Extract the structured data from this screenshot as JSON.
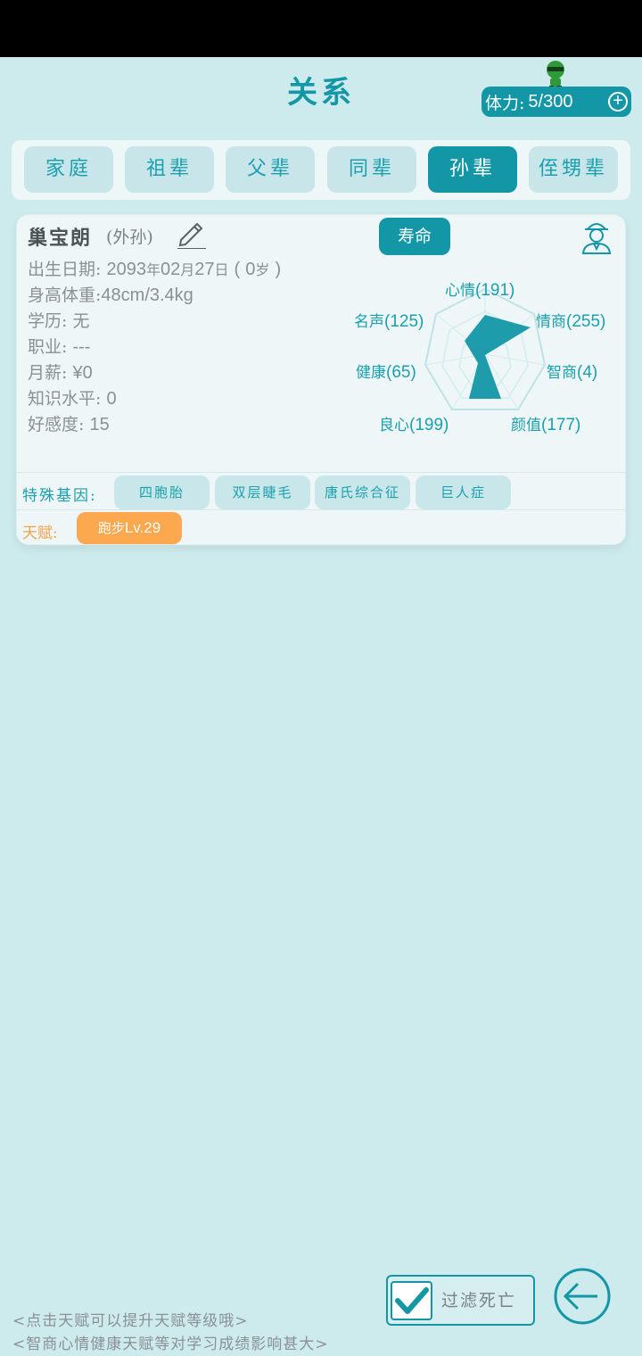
{
  "header": {
    "title": "关系",
    "stamina_label": "体力:",
    "stamina_value": "5/300"
  },
  "tabs": [
    {
      "label": "家庭",
      "active": false
    },
    {
      "label": "祖辈",
      "active": false
    },
    {
      "label": "父辈",
      "active": false
    },
    {
      "label": "同辈",
      "active": false
    },
    {
      "label": "孙辈",
      "active": true
    },
    {
      "label": "侄甥辈",
      "active": false
    }
  ],
  "card": {
    "name": "巢宝朗",
    "relation": "(外孙)",
    "lifespan_button": "寿命",
    "birth_label": "出生日期:",
    "birth_year": "2093",
    "birth_year_unit": "年",
    "birth_month": "02",
    "birth_month_unit": "月",
    "birth_day": "27",
    "birth_day_unit": "日",
    "age_open": "(",
    "age": "0",
    "age_unit": "岁",
    "age_close": ")",
    "height_weight_label": "身高体重:",
    "height_weight": "48cm/3.4kg",
    "education_label": "学历:",
    "education": "无",
    "job_label": "职业:",
    "job": "---",
    "salary_label": "月薪:",
    "salary": "¥0",
    "knowledge_label": "知识水平:",
    "knowledge": "0",
    "favor_label": "好感度:",
    "favor": "15",
    "stats": [
      {
        "name": "心情",
        "value": "(191)"
      },
      {
        "name": "情商",
        "value": "(255)"
      },
      {
        "name": "智商",
        "value": "(4)"
      },
      {
        "name": "颜值",
        "value": "(177)"
      },
      {
        "name": "良心",
        "value": "(199)"
      },
      {
        "name": "健康",
        "value": "(65)"
      },
      {
        "name": "名声",
        "value": "(125)"
      }
    ],
    "genes_label": "特殊基因:",
    "genes": [
      "四胞胎",
      "双层睫毛",
      "唐氏综合征",
      "巨人症"
    ],
    "talent_label": "天赋:",
    "talent_name": "跑步",
    "talent_level": "Lv.29"
  },
  "filter": {
    "label": "过滤死亡",
    "checked": true
  },
  "hints": [
    "<点击天赋可以提升天赋等级哦>",
    "<智商心情健康天赋等对学习成绩影响甚大>"
  ],
  "colors": {
    "accent": "#1397a6",
    "background": "#cdebed",
    "talent": "#fba84e"
  }
}
